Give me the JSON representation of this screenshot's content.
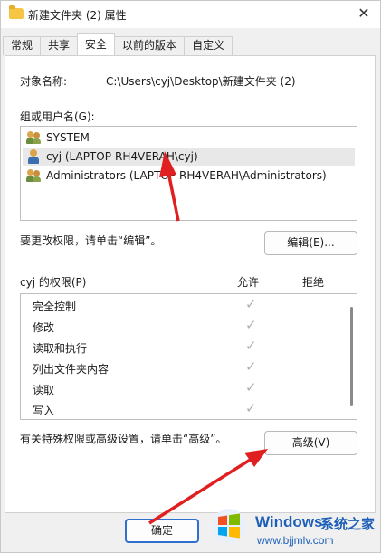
{
  "window": {
    "title": "新建文件夹 (2) 属性",
    "close_glyph": "✕"
  },
  "tabs": [
    {
      "label": "常规",
      "active": false
    },
    {
      "label": "共享",
      "active": false
    },
    {
      "label": "安全",
      "active": true
    },
    {
      "label": "以前的版本",
      "active": false
    },
    {
      "label": "自定义",
      "active": false
    }
  ],
  "security": {
    "object_name_label": "对象名称:",
    "object_name_value": "C:\\Users\\cyj\\Desktop\\新建文件夹 (2)",
    "group_label": "组或用户名(G):",
    "users": [
      {
        "name": "SYSTEM",
        "icon": "users-group-icon",
        "selected": false
      },
      {
        "name": "cyj (LAPTOP-RH4VERAH\\cyj)",
        "icon": "user-icon",
        "selected": true
      },
      {
        "name": "Administrators (LAPTOP-RH4VERAH\\Administrators)",
        "icon": "users-group-icon",
        "selected": false
      }
    ],
    "change_hint": "要更改权限，请单击“编辑”。",
    "edit_button": "编辑(E)...",
    "perm_header": "cyj 的权限(P)",
    "allow_header": "允许",
    "deny_header": "拒绝",
    "permissions": [
      {
        "name": "完全控制",
        "allow": "✓"
      },
      {
        "name": "修改",
        "allow": "✓"
      },
      {
        "name": "读取和执行",
        "allow": "✓"
      },
      {
        "name": "列出文件夹内容",
        "allow": "✓"
      },
      {
        "name": "读取",
        "allow": "✓"
      },
      {
        "name": "写入",
        "allow": "✓"
      }
    ],
    "advanced_hint": "有关特殊权限或高级设置，请单击“高级”。",
    "advanced_button": "高级(V)"
  },
  "footer": {
    "ok_button": "确定"
  },
  "watermark": {
    "title": "Windows",
    "title_cn": "系统之家",
    "url": "www.bjjmlv.com"
  },
  "colors": {
    "accent": "#2f6fd0",
    "arrow": "#e02020",
    "watermark": "#1d5fb8"
  }
}
